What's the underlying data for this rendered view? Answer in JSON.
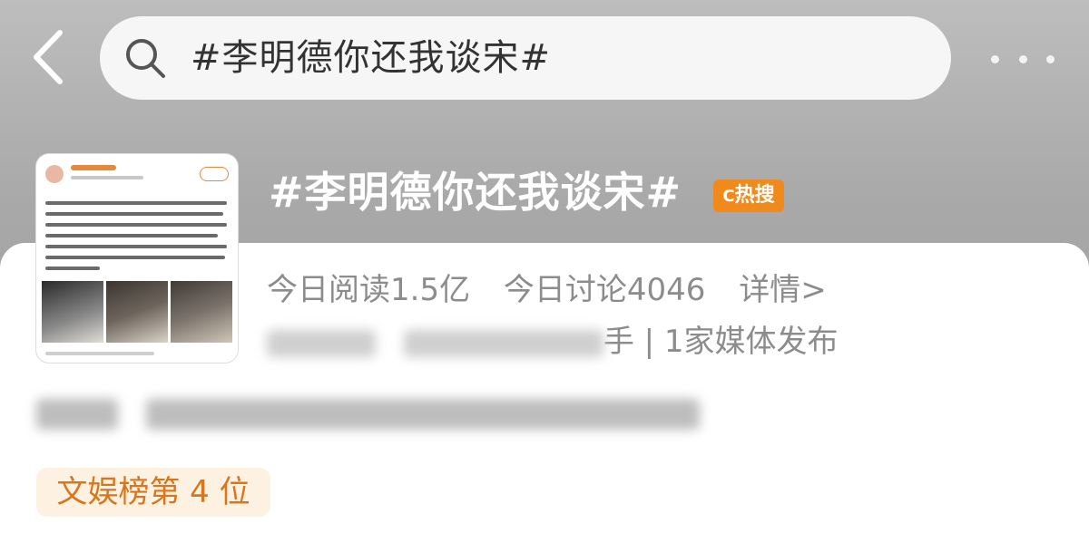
{
  "search": {
    "query": "#李明德你还我谈宋#"
  },
  "topic": {
    "title": "#李明德你还我谈宋#",
    "hot_label": "热搜",
    "stats": {
      "read": "今日阅读1.5亿",
      "discuss": "今日讨论4046",
      "detail": "详情>"
    },
    "hosts_suffix": "手 | 1家媒体发布",
    "rank": "文娱榜第 4 位"
  },
  "colors": {
    "accent": "#f08a1c",
    "rank_text": "#d9761c",
    "rank_bg": "#fdf1e2"
  },
  "icons": [
    "back-arrow-icon",
    "search-icon",
    "more-icon",
    "hot-search-icon"
  ]
}
